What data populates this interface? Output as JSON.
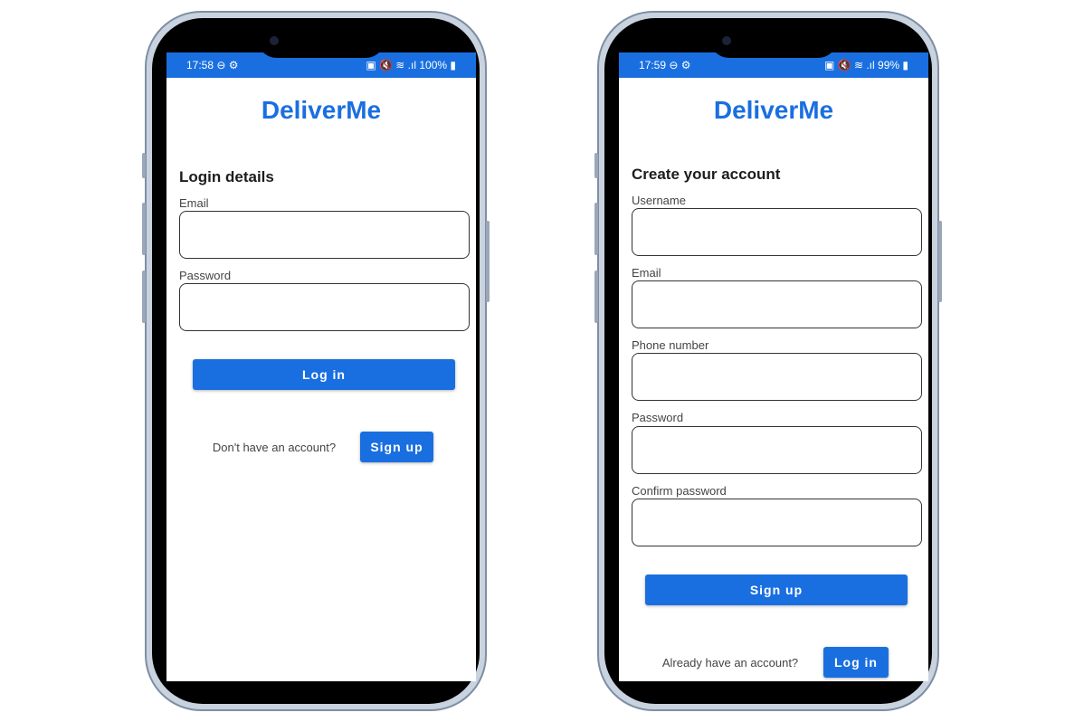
{
  "login_screen": {
    "status": {
      "time": "17:58",
      "icons_left": "⊖ ⚙",
      "icons_right": "▣ 🔇 ≋ .ıl",
      "battery": "100%"
    },
    "app_title": "DeliverMe",
    "heading": "Login details",
    "fields": [
      {
        "label": "Email",
        "value": ""
      },
      {
        "label": "Password",
        "value": ""
      }
    ],
    "login_button": "Log in",
    "prompt": "Don't have an account?",
    "signup_button": "Sign up"
  },
  "signup_screen": {
    "status": {
      "time": "17:59",
      "icons_left": "⊖ ⚙",
      "icons_right": "▣ 🔇 ≋ .ıl",
      "battery": "99%"
    },
    "app_title": "DeliverMe",
    "heading": "Create your account",
    "fields": [
      {
        "label": "Username",
        "value": ""
      },
      {
        "label": "Email",
        "value": ""
      },
      {
        "label": "Phone number",
        "value": ""
      },
      {
        "label": "Password",
        "value": ""
      },
      {
        "label": "Confirm password",
        "value": ""
      }
    ],
    "signup_button": "Sign up",
    "prompt": "Already have an account?",
    "login_button": "Log in"
  }
}
